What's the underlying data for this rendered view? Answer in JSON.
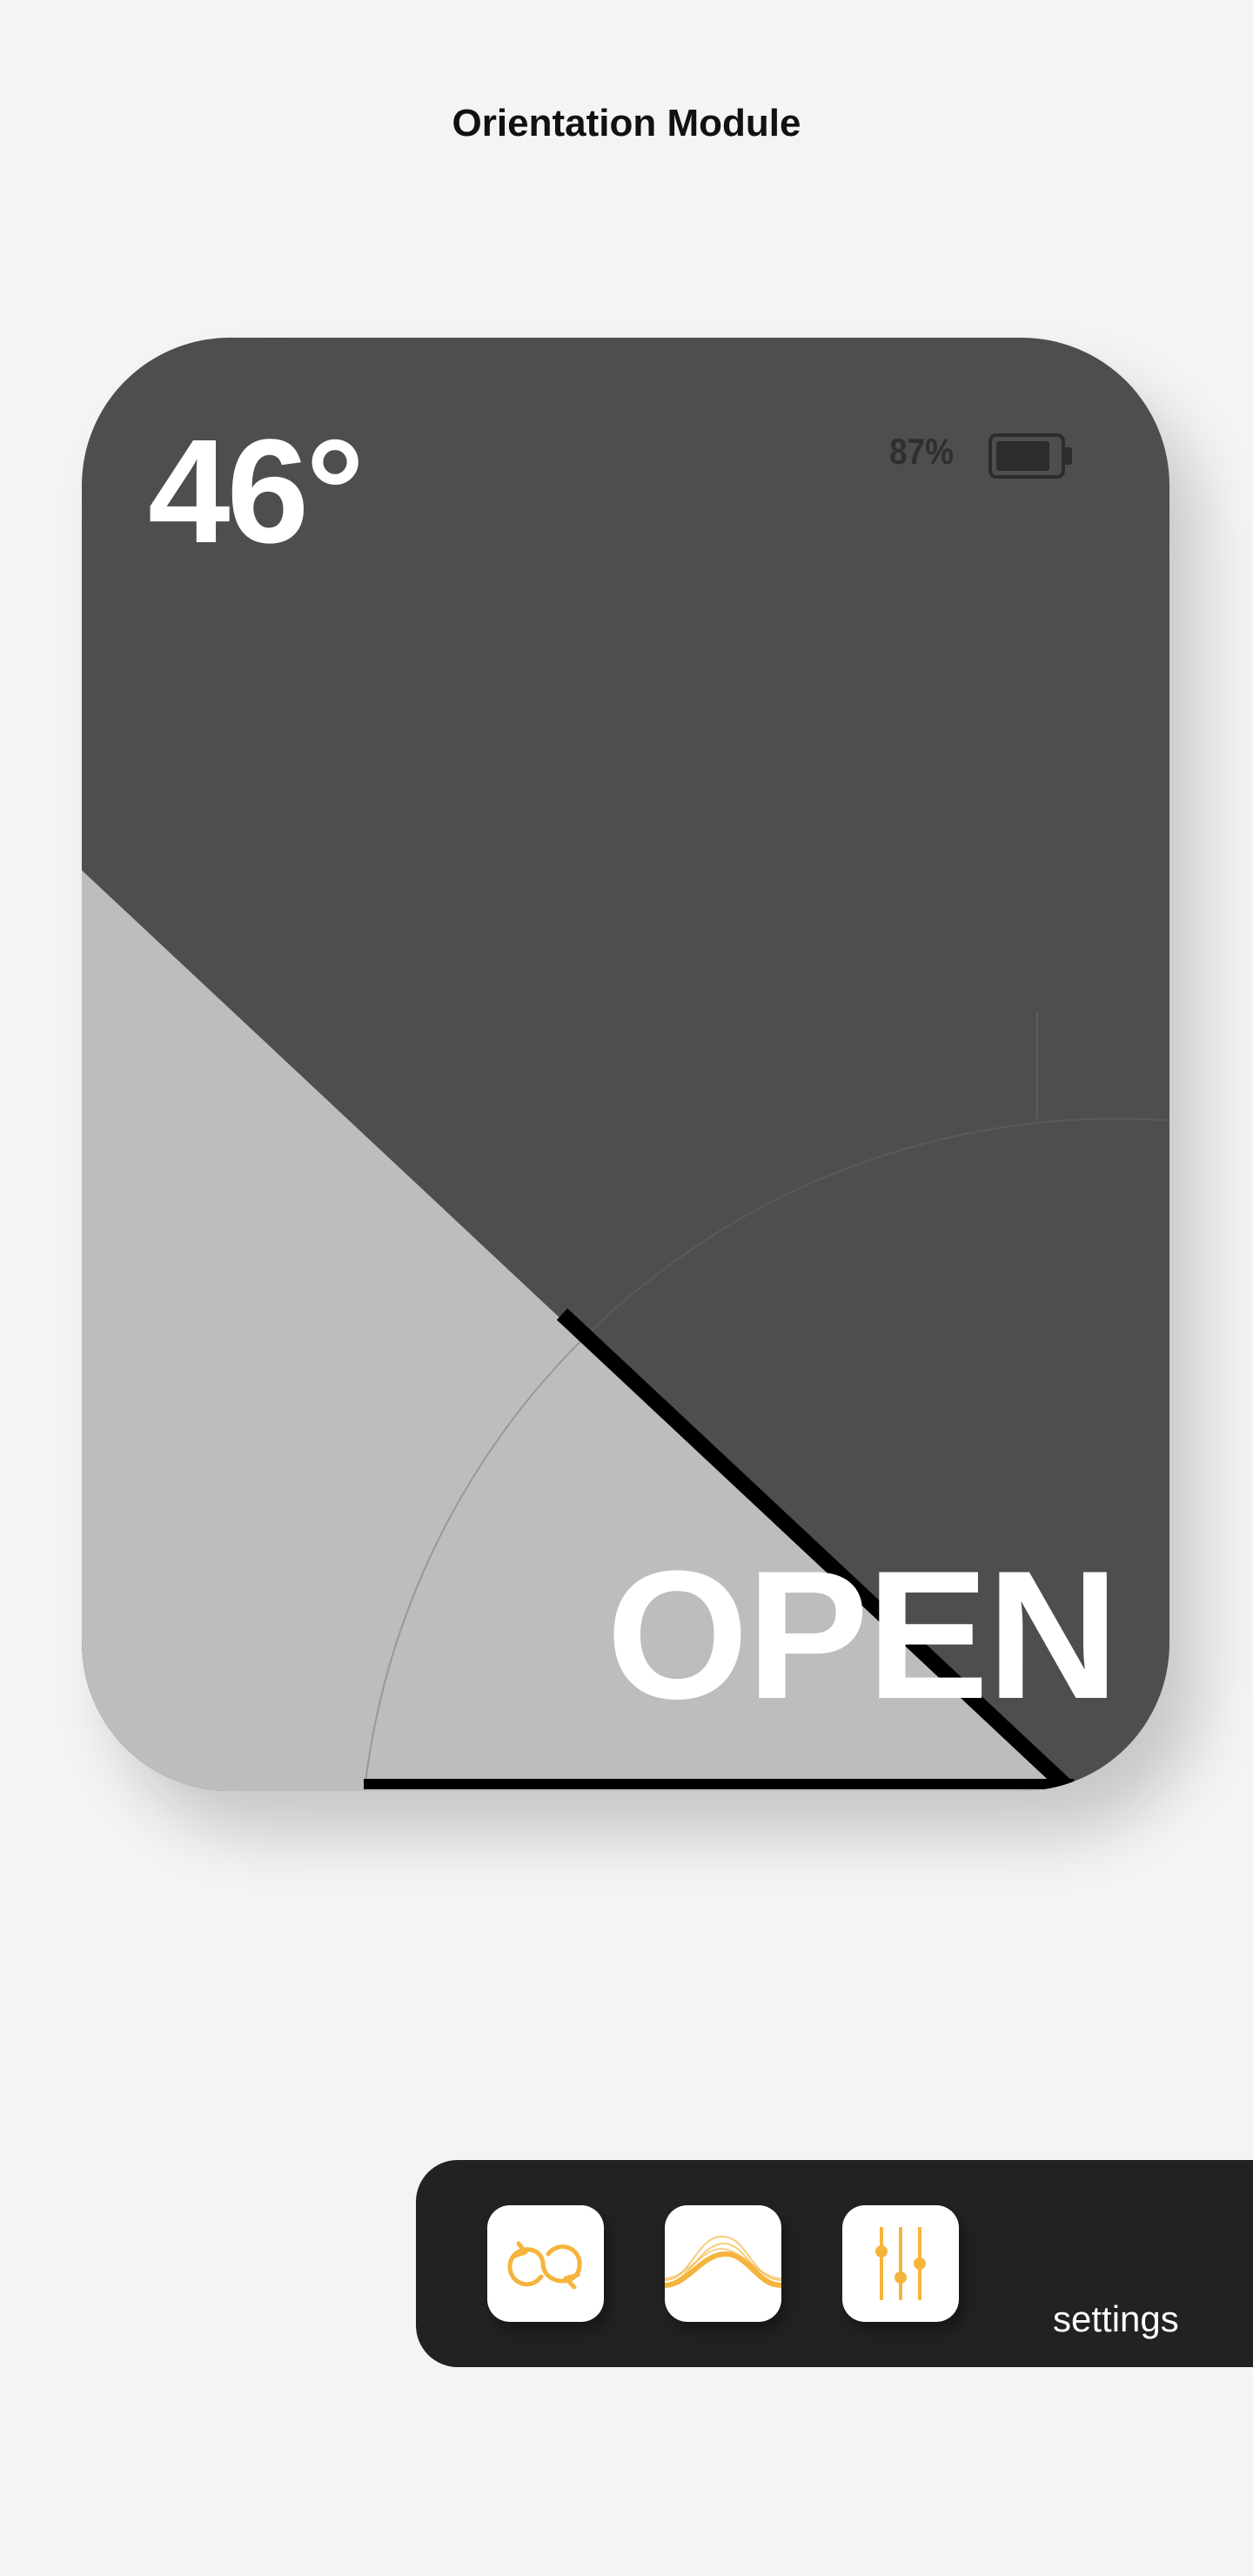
{
  "header": {
    "title": "Orientation Module"
  },
  "orientation": {
    "angle_text": "46°",
    "angle_degrees": 46,
    "status": "OPEN"
  },
  "battery": {
    "percent_text": "87%",
    "level": 0.87
  },
  "dock": {
    "tools": [
      {
        "icon": "rotate-cycle-icon"
      },
      {
        "icon": "waveform-icon"
      },
      {
        "icon": "sliders-icon"
      }
    ],
    "settings_label": "settings"
  },
  "colors": {
    "background": "#f4f4f4",
    "panel_dark": "#4e4e4e",
    "panel_light": "#bdbdbd",
    "accent": "#f5b43c",
    "dock": "#222222"
  }
}
